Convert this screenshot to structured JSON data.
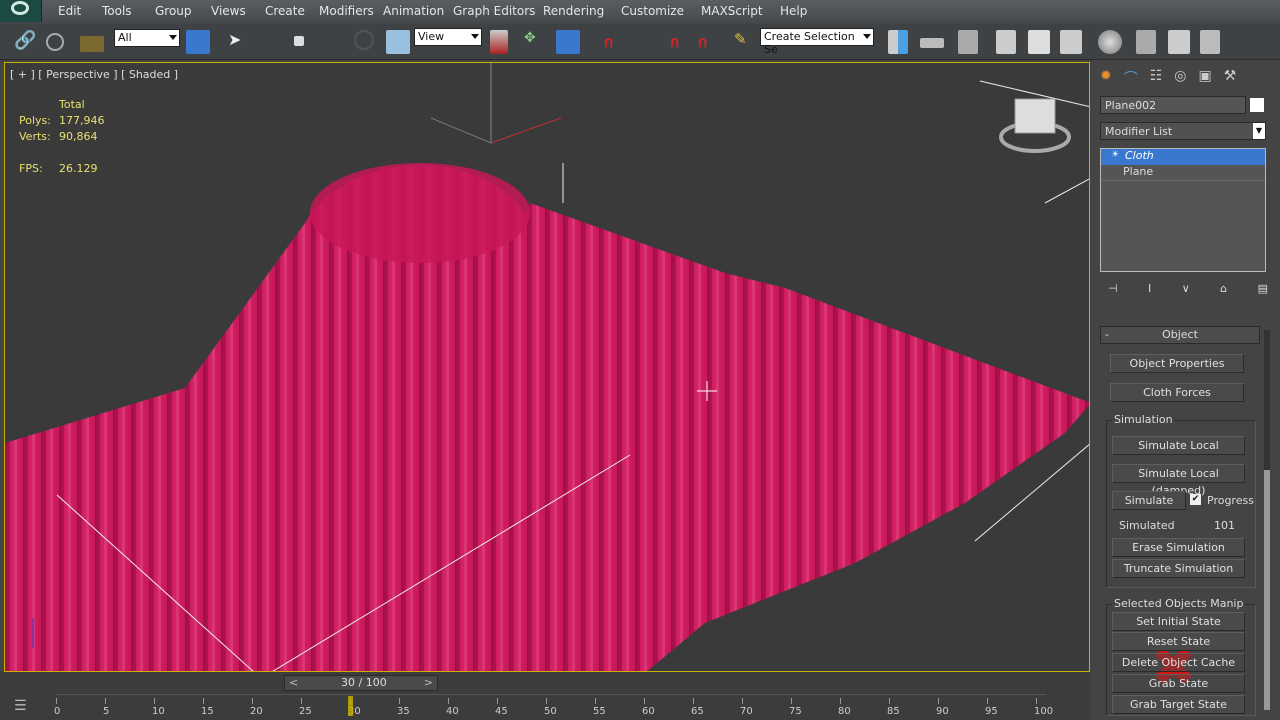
{
  "menu": [
    "Edit",
    "Tools",
    "Group",
    "Views",
    "Create",
    "Modifiers",
    "Animation",
    "Graph Editors",
    "Rendering",
    "Customize",
    "MAXScript",
    "Help"
  ],
  "toolbar": {
    "selection_filter": "All",
    "reference_coord": "View",
    "named_selection": "Create Selection Se"
  },
  "viewport": {
    "label": "[ + ] [ Perspective ] [ Shaded ]",
    "stats": {
      "header": "Total",
      "polys_label": "Polys:",
      "polys": "177,946",
      "verts_label": "Verts:",
      "verts": "90,864",
      "fps_label": "FPS:",
      "fps": "26.129"
    },
    "cloth_color": "#c8185a"
  },
  "panel": {
    "object_name": "Plane002",
    "modifier_list": "Modifier List",
    "stack": [
      "Cloth",
      "Plane"
    ],
    "rollout_title": "Object",
    "rollout_toggle": "-",
    "buttons": {
      "object_properties": "Object Properties",
      "cloth_forces": "Cloth Forces"
    },
    "simulation": {
      "label": "Simulation",
      "simulate_local": "Simulate Local",
      "simulate_local_damped": "Simulate Local (damped)",
      "simulate": "Simulate",
      "progress": "Progress",
      "progress_checked": true,
      "simulated_label": "Simulated",
      "simulated_value": "101",
      "erase": "Erase Simulation",
      "truncate": "Truncate Simulation"
    },
    "manip": {
      "label": "Selected Objects Manip",
      "set_initial": "Set Initial State",
      "reset": "Reset State",
      "delete_cache": "Delete Object Cache",
      "grab_state": "Grab State",
      "grab_target": "Grab Target State"
    }
  },
  "timeline": {
    "slider": "30 / 100",
    "current": 30,
    "total": 100,
    "prev": "<",
    "next": ">",
    "ticks": [
      "0",
      "5",
      "10",
      "15",
      "20",
      "25",
      "30",
      "35",
      "40",
      "45",
      "50",
      "55",
      "60",
      "65",
      "70",
      "75",
      "80",
      "85",
      "90",
      "95",
      "100"
    ]
  },
  "accent": "#3a78d0"
}
